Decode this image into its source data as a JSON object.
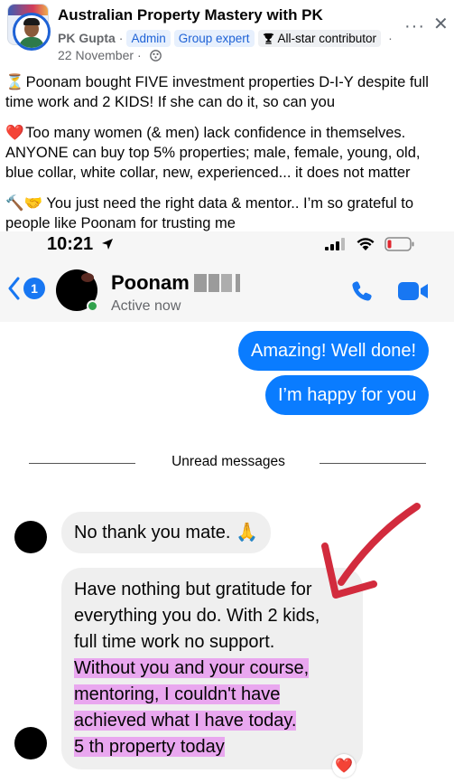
{
  "post": {
    "group_name": "Australian Property Mastery with PK",
    "author": "PK Gupta",
    "separator": "·",
    "badges": [
      "Admin",
      "Group expert",
      "All-star contributor"
    ],
    "date": "22 November",
    "date_separator": "·",
    "more_label": "···",
    "close_label": "✕",
    "paragraphs": [
      {
        "emoji": "⏳",
        "text": "Poonam bought FIVE investment properties D-I-Y despite full time work and 2 KIDS! If she can do it, so can you"
      },
      {
        "emoji": "❤️",
        "text": "Too many women (& men) lack confidence in themselves. ANYONE can buy top 5% properties; male, female, young, old, blue collar, white collar, new, experienced... it does not matter"
      },
      {
        "emoji": "🔨🤝",
        "text": "You just need the right data & mentor.. I’m so grateful to people like Poonam for trusting me"
      }
    ]
  },
  "messenger": {
    "status_bar": {
      "time": "10:21"
    },
    "contact": {
      "name": "Poonam",
      "status": "Active now",
      "unread_count": "1"
    },
    "outgoing": [
      "Amazing! Well done!",
      "I’m happy for you"
    ],
    "divider_label": "Unread messages",
    "incoming": {
      "first": "No thank you mate. 🙏",
      "second_lines": [
        "Have nothing but gratitude for",
        "everything you do. With 2 kids,",
        "full time work no support."
      ],
      "second_highlighted_lines": [
        "Without you and your course,",
        "mentoring, I couldn't have",
        "achieved what I have today.",
        "5 th property today"
      ]
    },
    "reaction": "❤️"
  },
  "colors": {
    "fb_blue": "#1e62d6",
    "messenger_blue": "#0a7cff",
    "highlight": "#e9a7ef",
    "annotation_arrow": "#d22b3d"
  }
}
